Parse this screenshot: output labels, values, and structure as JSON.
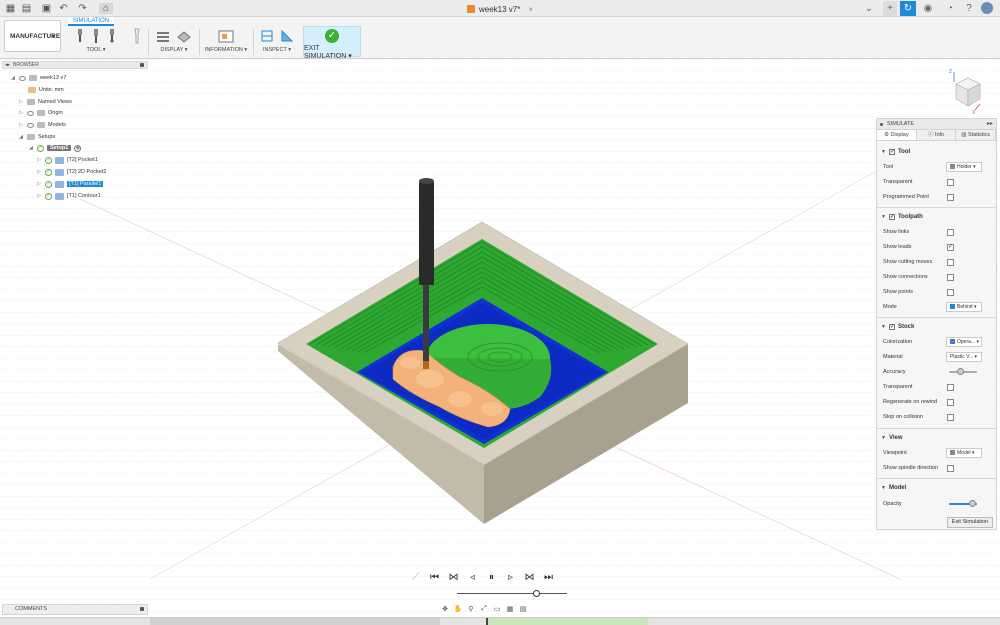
{
  "title_bar": {
    "document_tab": "week13 v7*"
  },
  "ribbon": {
    "workspace": "MANUFACTURE",
    "active_tab": "SIMULATION",
    "groups": {
      "tool": "TOOL",
      "display": "DISPLAY",
      "information": "INFORMATION",
      "inspect": "INSPECT",
      "exit_simulation": "EXIT SIMULATION"
    }
  },
  "browser": {
    "header": "BROWSER",
    "root": "week13 v7",
    "units": "Units: mm",
    "named_views": "Named Views",
    "origin": "Origin",
    "models": "Models",
    "setups": "Setups",
    "setup": "Setup1",
    "operations": [
      {
        "label": "[T2] Pocket1",
        "selected": false
      },
      {
        "label": "[T2] 2D Pocket2",
        "selected": false
      },
      {
        "label": "[T1] Parallel1",
        "selected": true
      },
      {
        "label": "[T1] Contour1",
        "selected": false
      }
    ]
  },
  "simulate_panel": {
    "header": "SIMULATE",
    "tabs": [
      "Display",
      "Info",
      "Statistics"
    ],
    "active_tab": "Display",
    "tool_section": {
      "title": "Tool",
      "tool_label": "Tool",
      "tool_value": "Holder",
      "transparent_label": "Transparent",
      "transparent_checked": false,
      "programmed_point_label": "Programmed Point",
      "programmed_point_checked": false
    },
    "toolpath_section": {
      "title": "Toolpath",
      "show_links": "Show links",
      "show_leads": "Show leads",
      "show_cutting_moves": "Show cutting moves",
      "show_connections": "Show connections",
      "show_points": "Show points",
      "mode_label": "Mode",
      "mode_value": "Behind"
    },
    "stock_section": {
      "title": "Stock",
      "colorization_label": "Colorization",
      "colorization_value": "Opera...",
      "material_label": "Material",
      "material_value": "Plastic V...",
      "accuracy_label": "Accuracy",
      "accuracy_level": 0.4,
      "transparent_label": "Transparent",
      "regenerate_label": "Regenerate on rewind",
      "stop_label": "Stop on collision"
    },
    "view_section": {
      "title": "View",
      "viewpoint_label": "Viewpoint",
      "viewpoint_value": "Model",
      "spindle_label": "Show spindle direction"
    },
    "model_section": {
      "title": "Model",
      "opacity_label": "Opacity",
      "opacity_level": 0.85
    },
    "exit_button": "Exit Simulation"
  },
  "comments": {
    "header": "COMMENTS"
  },
  "viewcube": {
    "axis_z": "Z",
    "axis_x": "X"
  },
  "colors": {
    "accent": "#1d8ad9",
    "stock_wall": "#d8d1c1",
    "cut_green": "#2fa832",
    "cut_blue": "#1031d4",
    "part_orange": "#f2b27a",
    "exit_check": "#3cb033"
  }
}
